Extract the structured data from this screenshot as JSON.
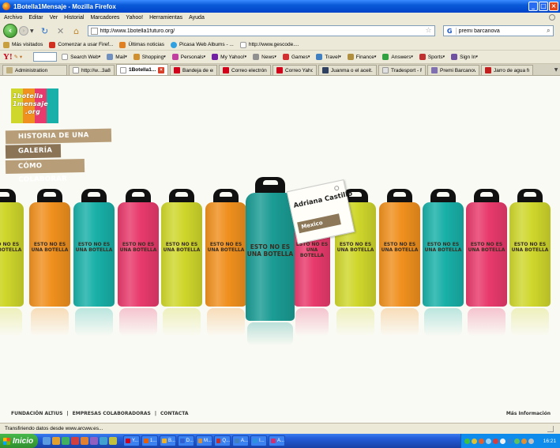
{
  "window": {
    "title": "1Botella1Mensaje - Mozilla Firefox",
    "controls": [
      "_",
      "□",
      "×"
    ]
  },
  "menubar": [
    "Archivo",
    "Editar",
    "Ver",
    "Historial",
    "Marcadores",
    "Yahoo!",
    "Herramientas",
    "Ayuda"
  ],
  "nav": {
    "url": "http://www.1botella1futuro.org/",
    "search_value": "premi barcanova"
  },
  "bookmarks": [
    {
      "label": "Más visitados",
      "color": "#c8a040"
    },
    {
      "label": "Comenzar a usar Firef...",
      "color": "#d03020"
    },
    {
      "label": "Últimas noticias",
      "color": "#e08020"
    },
    {
      "label": "Picasa Web Albums - ...",
      "color": "#30a0e0"
    },
    {
      "label": "http://www.gescode....",
      "color": "#ffffff"
    }
  ],
  "yahoo_toolbar": {
    "logo": "Y!",
    "items": [
      {
        "label": "Search Web",
        "color": "#ffffff"
      },
      {
        "label": "Mail",
        "color": "#7090c0"
      },
      {
        "label": "Shopping",
        "color": "#d09030"
      },
      {
        "label": "Personals",
        "color": "#c040a0"
      },
      {
        "label": "My Yahoo!",
        "color": "#7020a0"
      },
      {
        "label": "News",
        "color": "#909090"
      },
      {
        "label": "Games",
        "color": "#d03030"
      },
      {
        "label": "Travel",
        "color": "#4080c0"
      },
      {
        "label": "Finance",
        "color": "#b09040"
      },
      {
        "label": "Answers",
        "color": "#30a040"
      },
      {
        "label": "Sports",
        "color": "#c03030"
      },
      {
        "label": "Sign In",
        "color": "#7050a0"
      }
    ]
  },
  "tabs": [
    {
      "label": "Administration",
      "color": "#c0b080",
      "active": false,
      "width": 82
    },
    {
      "label": "http://w...3a8d8dj...",
      "color": "#ffffff",
      "active": false,
      "width": 58
    },
    {
      "label": "1Botella1...",
      "color": "#ffffff",
      "active": true,
      "width": 66
    },
    {
      "label": "Bandeja de entra...",
      "color": "#d0021b",
      "active": false,
      "width": 60
    },
    {
      "label": "Correo electrónic...",
      "color": "#d0021b",
      "active": false,
      "width": 66
    },
    {
      "label": "Correo Yahoo!",
      "color": "#d0021b",
      "active": false,
      "width": 56
    },
    {
      "label": "Juanma o el aceit...",
      "color": "#304060",
      "active": false,
      "width": 74
    },
    {
      "label": "Tradesport - Flas...",
      "color": "#e0e0e0",
      "active": false,
      "width": 60
    },
    {
      "label": "Premi Barcanova",
      "color": "#8070b0",
      "active": false,
      "width": 66
    },
    {
      "label": "Jarro de agua frí...",
      "color": "#c02020",
      "active": false,
      "width": 66
    }
  ],
  "site": {
    "logo_lines": [
      "1botella",
      "1mensaje",
      ".org"
    ],
    "menu": [
      "HISTORIA DE UNA BOTELLA",
      "GALERÍA",
      "CÓMO COLABORAR"
    ],
    "bottle_label_line1": "ESTO NO ES",
    "bottle_label_line2": "UNA BOTELLA",
    "tag_name": "Adriana Castillo",
    "tag_country": "Mexico",
    "footer_links": [
      "FUNDACIÓN ALTIUS",
      "EMPRESAS COLABORADORAS",
      "CONTACTA"
    ],
    "footer_right": "Más Información",
    "colors": {
      "lime": "#cfd72c",
      "orange": "#f0901e",
      "teal": "#18b0a8",
      "pink": "#e83a6c",
      "featured": "#1a9c94",
      "menu_bg": "#b79e78",
      "menu_active_bg": "#8b7355"
    }
  },
  "status": "Transfiriendo datos desde www.arcww.es...",
  "taskbar": {
    "start_label": "Inicio",
    "buttons": [
      {
        "label": "Y...",
        "color": "#d0021b"
      },
      {
        "label": "1...",
        "color": "#e06010"
      },
      {
        "label": "B...",
        "color": "#f0b020"
      },
      {
        "label": "D...",
        "color": "#3060d0"
      },
      {
        "label": "M...",
        "color": "#d09040"
      },
      {
        "label": "Q...",
        "color": "#c03030"
      },
      {
        "label": "A...",
        "color": "#4080c0"
      },
      {
        "label": "I...",
        "color": "#3090e0"
      },
      {
        "label": "A...",
        "color": "#d03070"
      }
    ],
    "clock": "16:21"
  }
}
